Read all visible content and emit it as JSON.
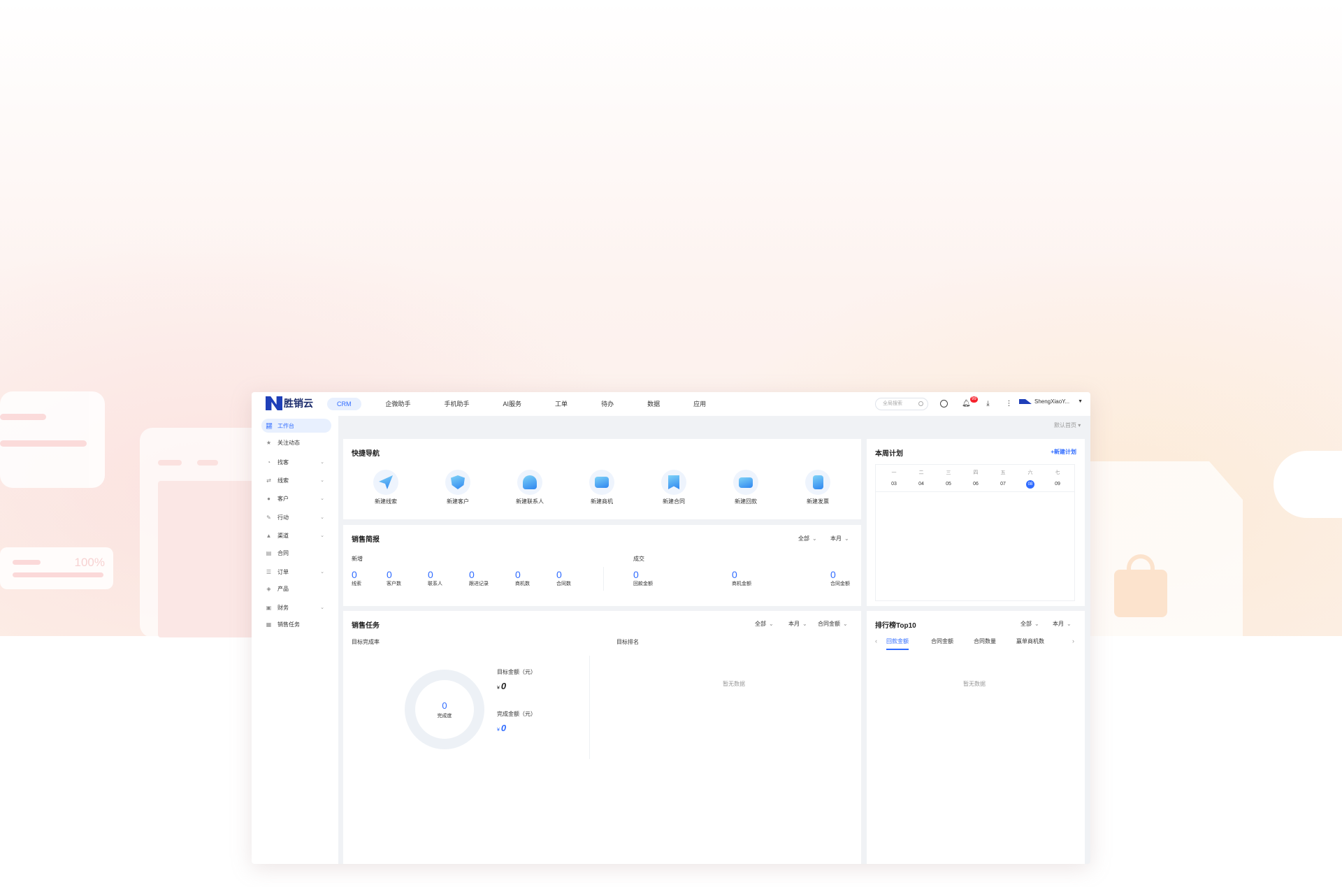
{
  "topnav": {
    "logo_text": "胜销云",
    "items": [
      "CRM",
      "企微助手",
      "手机助手",
      "AI服务",
      "工单",
      "待办",
      "数据",
      "应用"
    ],
    "search_placeholder": "全局搜索",
    "badge": "99",
    "user_name": "ShengXiaoY..."
  },
  "sidebar": {
    "items": [
      {
        "label": "工作台",
        "icon": "chart-icon"
      },
      {
        "label": "关注动态",
        "icon": "star-icon"
      },
      {
        "label": "找客",
        "icon": "pie-icon"
      },
      {
        "label": "线索",
        "icon": "swap-icon"
      },
      {
        "label": "客户",
        "icon": "user-icon"
      },
      {
        "label": "行动",
        "icon": "edit-icon"
      },
      {
        "label": "渠道",
        "icon": "group-icon"
      },
      {
        "label": "合同",
        "icon": "doc-icon"
      },
      {
        "label": "订单",
        "icon": "list-icon"
      },
      {
        "label": "产品",
        "icon": "cube-icon"
      },
      {
        "label": "财务",
        "icon": "wallet-icon"
      },
      {
        "label": "销售任务",
        "icon": "task-icon"
      }
    ]
  },
  "breadcrumb": "默认首页",
  "quick_nav": {
    "title": "快捷导航",
    "items": [
      "新建线索",
      "新建客户",
      "新建联系人",
      "新建商机",
      "新建合同",
      "新建回款",
      "新建发票"
    ]
  },
  "weekly_plan": {
    "title": "本周计划",
    "new_label": "+新建计划",
    "weekdays": [
      "一",
      "二",
      "三",
      "四",
      "五",
      "六",
      "七"
    ],
    "days": [
      "03",
      "04",
      "05",
      "06",
      "07",
      "08",
      "09"
    ],
    "today_index": 5
  },
  "sales_brief": {
    "title": "销售简报",
    "filter_scope": "全部",
    "filter_period": "本月",
    "new_label": "新增",
    "deal_label": "成交",
    "new_stats": [
      {
        "value": "0",
        "label": "线索"
      },
      {
        "value": "0",
        "label": "客户数"
      },
      {
        "value": "0",
        "label": "联系人"
      },
      {
        "value": "0",
        "label": "跟进记录"
      },
      {
        "value": "0",
        "label": "商机数"
      },
      {
        "value": "0",
        "label": "合同数"
      }
    ],
    "deal_stats": [
      {
        "value": "0",
        "label": "回款金额"
      },
      {
        "value": "0",
        "label": "商机金额"
      },
      {
        "value": "0",
        "label": "合同金额"
      }
    ]
  },
  "sales_task": {
    "title": "销售任务",
    "filter_scope": "全部",
    "filter_period": "本月",
    "filter_metric": "合同金额",
    "completion_label": "目标完成率",
    "ranking_label": "目标排名",
    "ring_value": "0",
    "ring_label": "完成度",
    "target_label": "目标金额（元）",
    "target_value": "0",
    "done_label": "完成金额（元）",
    "done_value": "0",
    "currency": "¥",
    "empty": "暂无数据"
  },
  "ranking": {
    "title": "排行榜Top10",
    "filter_scope": "全部",
    "filter_period": "本月",
    "tabs": [
      "回款金额",
      "合同金额",
      "合同数量",
      "赢单商机数"
    ],
    "active_tab": 0,
    "empty": "暂无数据"
  },
  "deco": {
    "percent": "100%"
  },
  "colors": {
    "accent": "#2f6bff",
    "brand": "#1f3fb8",
    "badge": "#f5222d"
  }
}
